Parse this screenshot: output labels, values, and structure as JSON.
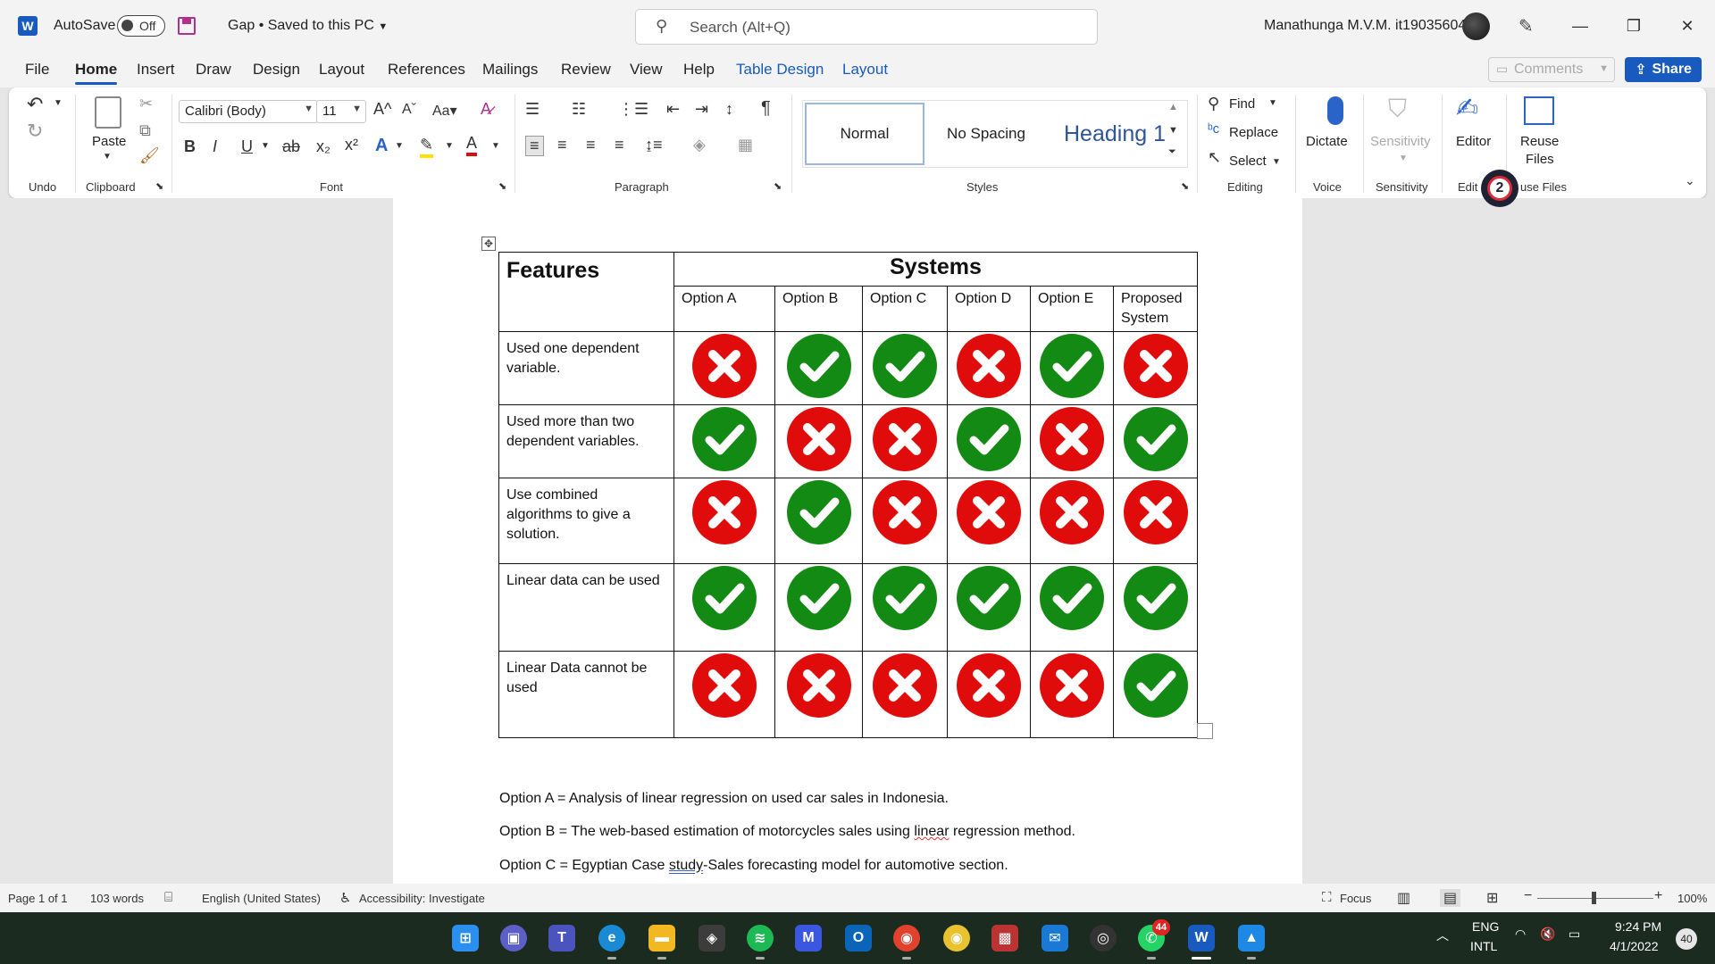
{
  "titlebar": {
    "app_logo": "W",
    "autosave_label": "AutoSave",
    "autosave_state": "Off",
    "doc_title": "Gap • Saved to this PC",
    "search_placeholder": "Search (Alt+Q)",
    "user_name": "Manathunga M.V.M. it19035604"
  },
  "menu": {
    "tabs": [
      "File",
      "Home",
      "Insert",
      "Draw",
      "Design",
      "Layout",
      "References",
      "Mailings",
      "Review",
      "View",
      "Help",
      "Table Design",
      "Layout"
    ],
    "active": "Home",
    "comments": "Comments",
    "share": "Share"
  },
  "ribbon": {
    "groups": {
      "undo": "Undo",
      "clipboard": "Clipboard",
      "font": "Font",
      "paragraph": "Paragraph",
      "styles": "Styles",
      "editing": "Editing",
      "voice": "Voice",
      "sensitivity": "Sensitivity",
      "editor": "Edit",
      "reuse": "use Files"
    },
    "paste": "Paste",
    "font_name": "Calibri (Body)",
    "font_size": "11",
    "styles": [
      "Normal",
      "No Spacing",
      "Heading 1"
    ],
    "find": "Find",
    "replace": "Replace",
    "select": "Select",
    "dictate": "Dictate",
    "sensitivity": "Sensitivity",
    "editor": "Editor",
    "reuse_files_line1": "Reuse",
    "reuse_files_line2": "Files"
  },
  "badge": "2",
  "table": {
    "features_header": "Features",
    "systems_header": "Systems",
    "options": [
      "Option A",
      "Option B",
      "Option C",
      "Option D",
      "Option E",
      "Proposed System"
    ],
    "rows": [
      {
        "feature": "Used one dependent variable.",
        "marks": [
          "cross",
          "check",
          "check",
          "cross",
          "check",
          "cross"
        ]
      },
      {
        "feature": "Used more than two dependent variables.",
        "marks": [
          "check",
          "cross",
          "cross",
          "check",
          "cross",
          "check"
        ]
      },
      {
        "feature": "Use combined algorithms to give a solution.",
        "marks": [
          "cross",
          "check",
          "cross",
          "cross",
          "cross",
          "cross"
        ]
      },
      {
        "feature": "Linear data can be used",
        "marks": [
          "check",
          "check",
          "check",
          "check",
          "check",
          "check"
        ]
      },
      {
        "feature": "Linear Data cannot be used",
        "marks": [
          "cross",
          "cross",
          "cross",
          "cross",
          "cross",
          "check"
        ]
      }
    ]
  },
  "paragraphs": {
    "a": "Option A = Analysis of linear regression on used car sales in Indonesia.",
    "b_pre": "Option B = The web-based estimation of motorcycles sales using ",
    "b_err": "linear",
    "b_post": " regression method.",
    "c_pre": "Option C = Egyptian Case ",
    "c_err": "study",
    "c_post": "-Sales forecasting model for automotive section."
  },
  "status": {
    "page": "Page 1 of 1",
    "words": "103 words",
    "language": "English (United States)",
    "accessibility": "Accessibility: Investigate",
    "focus": "Focus",
    "zoom": "100%"
  },
  "taskbar": {
    "whatsapp_badge": "44",
    "lang_line1": "ENG",
    "lang_line2": "INTL",
    "time": "9:24 PM",
    "date": "4/1/2022",
    "notif_count": "40"
  },
  "colors": {
    "word_blue": "#185abd",
    "check_green": "#138a13",
    "cross_red": "#e00b0b"
  }
}
